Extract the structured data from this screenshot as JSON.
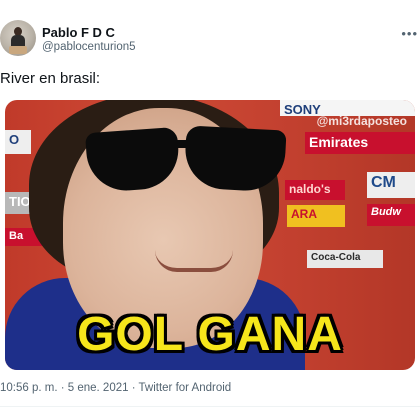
{
  "author": {
    "display_name": "Pablo F D C",
    "handle": "@pablocenturion5"
  },
  "header": {
    "more_icon": "more-horizontal-icon"
  },
  "tweet": {
    "text": "River en brasil:",
    "media": {
      "watermark": "@mi3rdaposteo",
      "caption": "GOL GANA",
      "boards": [
        "SONY",
        "Emirates",
        "O",
        "TION",
        "Ba",
        "naldo's",
        "CM",
        "ARA",
        "Budw",
        "Coca-Cola"
      ]
    },
    "timestamp": "10:56 p. m. · 5 ene. 2021 · Twitter for Android"
  },
  "colors": {
    "caption": "#f6e61b",
    "secondary_text": "#536471"
  }
}
